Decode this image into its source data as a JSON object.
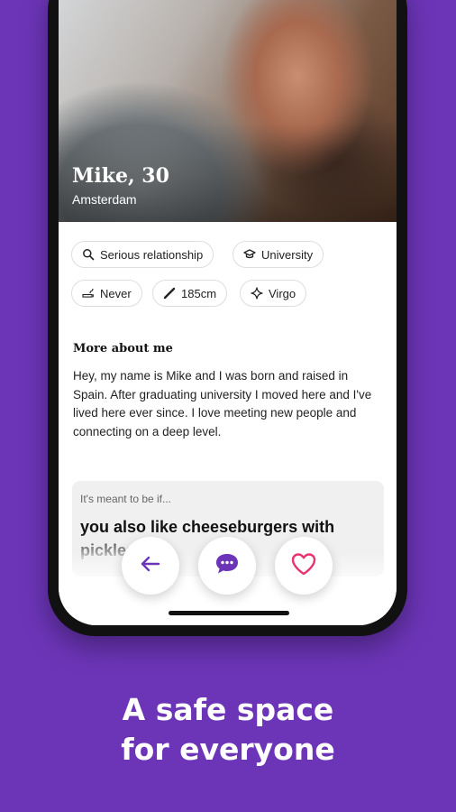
{
  "profile": {
    "name_age": "Mike, 30",
    "city": "Amsterdam"
  },
  "chips": [
    {
      "label": "Serious relationship",
      "icon": "search-icon"
    },
    {
      "label": "University",
      "icon": "graduation-cap-icon"
    },
    {
      "label": "Never",
      "icon": "no-smoking-icon"
    },
    {
      "label": "185cm",
      "icon": "ruler-icon"
    },
    {
      "label": "Virgo",
      "icon": "sparkle-icon"
    }
  ],
  "about": {
    "title": "More about me",
    "text": "Hey, my name is Mike and I was born and raised in Spain. After graduating university I moved here and I've lived here ever since. I love meeting new people and connecting on a deep level."
  },
  "prompt": {
    "label": "It's meant to be if...",
    "text": "you also like cheeseburgers with pickles"
  },
  "actions": [
    {
      "icon": "arrow-left-icon"
    },
    {
      "icon": "chat-bubble-icon"
    },
    {
      "icon": "heart-icon"
    }
  ],
  "tagline": {
    "line1": "A safe space",
    "line2": "for everyone"
  },
  "colors": {
    "background": "#6c35b8",
    "accent_purple": "#6c35b8",
    "heart_pink": "#e8336e"
  }
}
